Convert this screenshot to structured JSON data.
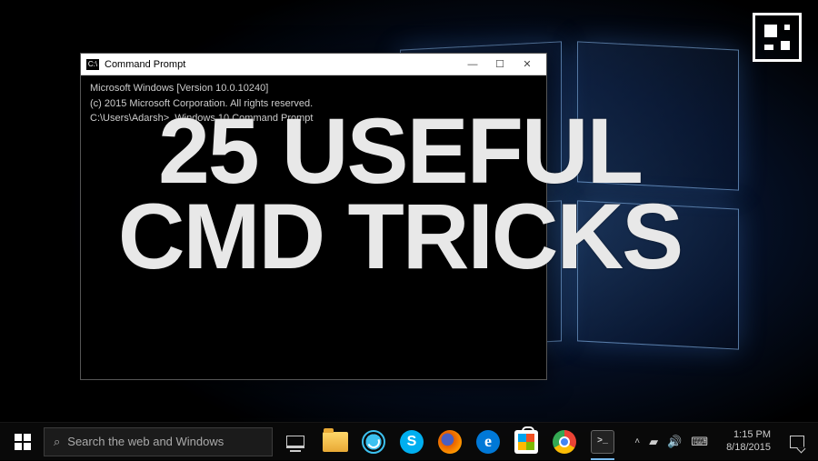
{
  "window": {
    "title": "Command Prompt",
    "icon_glyph": "C:\\",
    "btn_min": "—",
    "btn_max": "☐",
    "btn_close": "✕"
  },
  "terminal": {
    "line1": "Microsoft Windows [Version 10.0.10240]",
    "line2": "(c) 2015 Microsoft Corporation. All rights reserved.",
    "blank": " ",
    "prompt": "C:\\Users\\Adarsh>",
    "input": "Windows 10 Command Prompt"
  },
  "overlay": {
    "line1": "25 USEFUL",
    "line2": "CMD TRICKS"
  },
  "taskbar": {
    "search_placeholder": "Search the web and Windows",
    "tray": {
      "chevron": "˄",
      "time": "1:15 PM",
      "date": "8/18/2015"
    }
  }
}
